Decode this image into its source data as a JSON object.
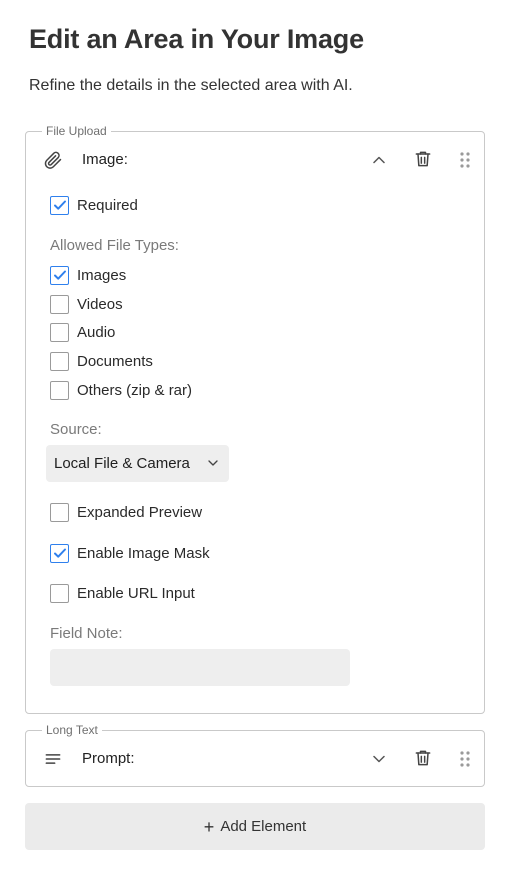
{
  "page": {
    "title": "Edit an Area in Your Image",
    "subtitle": "Refine the details in the selected area with AI."
  },
  "upload_card": {
    "legend": "File Upload",
    "icon": "paperclip-icon",
    "label": "Image:",
    "expanded": true,
    "required": {
      "label": "Required",
      "checked": true
    },
    "allowed_types_label": "Allowed File Types:",
    "file_types": [
      {
        "label": "Images",
        "checked": true
      },
      {
        "label": "Videos",
        "checked": false
      },
      {
        "label": "Audio",
        "checked": false
      },
      {
        "label": "Documents",
        "checked": false
      },
      {
        "label": "Others (zip & rar)",
        "checked": false
      }
    ],
    "source_label": "Source:",
    "source_value": "Local File & Camera",
    "options": [
      {
        "label": "Expanded Preview",
        "checked": false
      },
      {
        "label": "Enable Image Mask",
        "checked": true
      },
      {
        "label": "Enable URL Input",
        "checked": false
      }
    ],
    "field_note_label": "Field Note:",
    "field_note_value": ""
  },
  "longtext_card": {
    "legend": "Long Text",
    "icon": "text-lines-icon",
    "label": "Prompt:",
    "expanded": false
  },
  "add_element": {
    "plus": "+",
    "label": "Add Element"
  },
  "colors": {
    "accent": "#2f80ed",
    "border": "#c9c9c9",
    "input_bg": "#eeeeee",
    "button_bg": "#ebebeb"
  }
}
